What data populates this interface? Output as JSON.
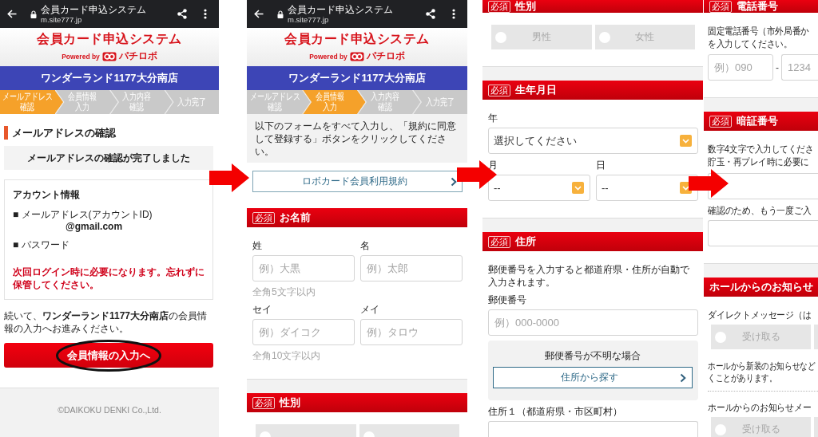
{
  "panels": [
    {
      "browser": {
        "title": "会員カード申込システム",
        "url": "m.site777.jp"
      },
      "site_header": {
        "title": "会員カード申込システム",
        "powered_by": "Powered by",
        "brand": "パチロボ"
      },
      "store_name": "ワンダーランド1177大分南店",
      "steps": [
        {
          "lines": [
            "メールアドレス",
            "確認"
          ],
          "selected": true
        },
        {
          "lines": [
            "会員情報",
            "入力"
          ],
          "selected": false
        },
        {
          "lines": [
            "入力内容",
            "確認"
          ],
          "selected": false
        },
        {
          "lines": [
            "入力完了"
          ],
          "selected": false
        }
      ],
      "blocks": [
        {
          "kind": "heading",
          "text": "メールアドレスの確認"
        },
        {
          "kind": "notice",
          "text": "メールアドレスの確認が完了しました"
        },
        {
          "kind": "info_card",
          "title": "アカウント情報",
          "items": [
            {
              "label": "■ メールアドレス(アカウントID)",
              "value": "@gmail.com"
            },
            {
              "label": "■ パスワード"
            }
          ],
          "warning": "次回ログイン時に必要になります。忘れずに保管してください。"
        },
        {
          "kind": "paragraph",
          "text": "続いて、**ワンダーランド1177大分南店**の会員情報の入力へお進みください。"
        },
        {
          "kind": "primary_button",
          "label": "会員情報の入力へ",
          "circled": true
        },
        {
          "kind": "footer",
          "text": "©DAIKOKU DENKI Co.,Ltd."
        }
      ]
    },
    {
      "browser": {
        "title": "会員カード申込システム",
        "url": "m.site777.jp"
      },
      "site_header": {
        "title": "会員カード申込システム",
        "powered_by": "Powered by",
        "brand": "パチロボ"
      },
      "store_name": "ワンダーランド1177大分南店",
      "steps": [
        {
          "lines": [
            "メールアドレス",
            "確認"
          ],
          "selected": false
        },
        {
          "lines": [
            "会員情報",
            "入力"
          ],
          "selected": true
        },
        {
          "lines": [
            "入力内容",
            "確認"
          ],
          "selected": false
        },
        {
          "lines": [
            "入力完了"
          ],
          "selected": false
        }
      ],
      "blocks": [
        {
          "kind": "instruction",
          "text": "以下のフォームをすべて入力し、「規約に同意して登録する」ボタンをクリックしてください。"
        },
        {
          "kind": "link_button",
          "label": "ロボカード会員利用規約"
        },
        {
          "kind": "section",
          "badge": "必須",
          "title": "お名前",
          "items": [
            {
              "kind": "row",
              "cells": [
                {
                  "kind": "input",
                  "label": "姓",
                  "placeholder": "例）大黒"
                },
                {
                  "kind": "input",
                  "label": "名",
                  "placeholder": "例）太郎"
                }
              ]
            },
            {
              "kind": "hint",
              "text": "全角5文字以内"
            },
            {
              "kind": "row",
              "cells": [
                {
                  "kind": "input",
                  "label": "セイ",
                  "placeholder": "例）ダイコク"
                },
                {
                  "kind": "input",
                  "label": "メイ",
                  "placeholder": "例）タロウ"
                }
              ]
            },
            {
              "kind": "hint",
              "text": "全角10文字以内"
            }
          ]
        },
        {
          "kind": "section",
          "badge": "必須",
          "title": "性別",
          "items": [
            {
              "kind": "radio",
              "options": [
                {
                  "selected": false
                },
                {
                  "selected": false
                }
              ]
            }
          ]
        }
      ]
    },
    {
      "blocks": [
        {
          "kind": "section",
          "badge": "必須",
          "title": "性別",
          "items": [
            {
              "kind": "radio",
              "options": [
                {
                  "label": "男性",
                  "selected": false
                },
                {
                  "label": "女性",
                  "selected": false
                }
              ]
            }
          ]
        },
        {
          "kind": "section",
          "badge": "必須",
          "title": "生年月日",
          "items": [
            {
              "kind": "row",
              "cells": [
                {
                  "kind": "select",
                  "label": "年",
                  "value": "選択してください"
                }
              ]
            },
            {
              "kind": "row",
              "cells": [
                {
                  "kind": "select",
                  "label": "月",
                  "value": "--"
                },
                {
                  "kind": "select",
                  "label": "日",
                  "value": "--"
                }
              ]
            }
          ]
        },
        {
          "kind": "section",
          "badge": "必須",
          "title": "住所",
          "items": [
            {
              "kind": "text",
              "text": "郵便番号を入力すると都道府県・住所が自動で入力されます。"
            },
            {
              "kind": "row",
              "cells": [
                {
                  "kind": "input",
                  "label": "郵便番号",
                  "placeholder": "例）000-0000"
                }
              ]
            },
            {
              "kind": "lookup",
              "title": "郵便番号が不明な場合",
              "button": "住所から探す"
            },
            {
              "kind": "row",
              "cells": [
                {
                  "kind": "input",
                  "label": "住所１（都道府県・市区町村）"
                }
              ]
            }
          ]
        }
      ]
    },
    {
      "blocks": [
        {
          "kind": "section",
          "badge": "必須",
          "title": "電話番号",
          "items": [
            {
              "kind": "text",
              "lines": [
                "固定電話番号（市外局番か",
                "を入力してください。"
              ]
            },
            {
              "kind": "phone",
              "separator": "-",
              "fields": [
                {
                  "placeholder": "例）090"
                },
                {
                  "placeholder": "1234"
                }
              ]
            }
          ]
        },
        {
          "kind": "section",
          "badge": "必須",
          "title": "暗証番号",
          "items": [
            {
              "kind": "text",
              "lines": [
                "数字4文字で入力してくださ",
                "貯玉・再プレイ時に必要に"
              ]
            },
            {
              "kind": "row",
              "cells": [
                {
                  "kind": "input"
                }
              ]
            },
            {
              "kind": "row",
              "cells": [
                {
                  "kind": "input",
                  "label": "確認のため、もう一度ご入"
                }
              ]
            }
          ]
        },
        {
          "kind": "section",
          "title": "ホールからのお知らせ",
          "items": [
            {
              "kind": "radio",
              "label": "ダイレクトメッセージ（は",
              "options": [
                {
                  "label": "受け取る",
                  "selected": false
                },
                {
                  "selected": false
                }
              ]
            },
            {
              "kind": "note",
              "lines": [
                "ホールから新装のお知らせなど",
                "くことがあります。"
              ]
            },
            {
              "kind": "dotted_divider"
            },
            {
              "kind": "radio",
              "label": "ホールからのお知らせメー",
              "options": [
                {
                  "label": "受け取る",
                  "selected": false
                },
                {
                  "selected": false
                }
              ]
            }
          ]
        }
      ]
    }
  ]
}
